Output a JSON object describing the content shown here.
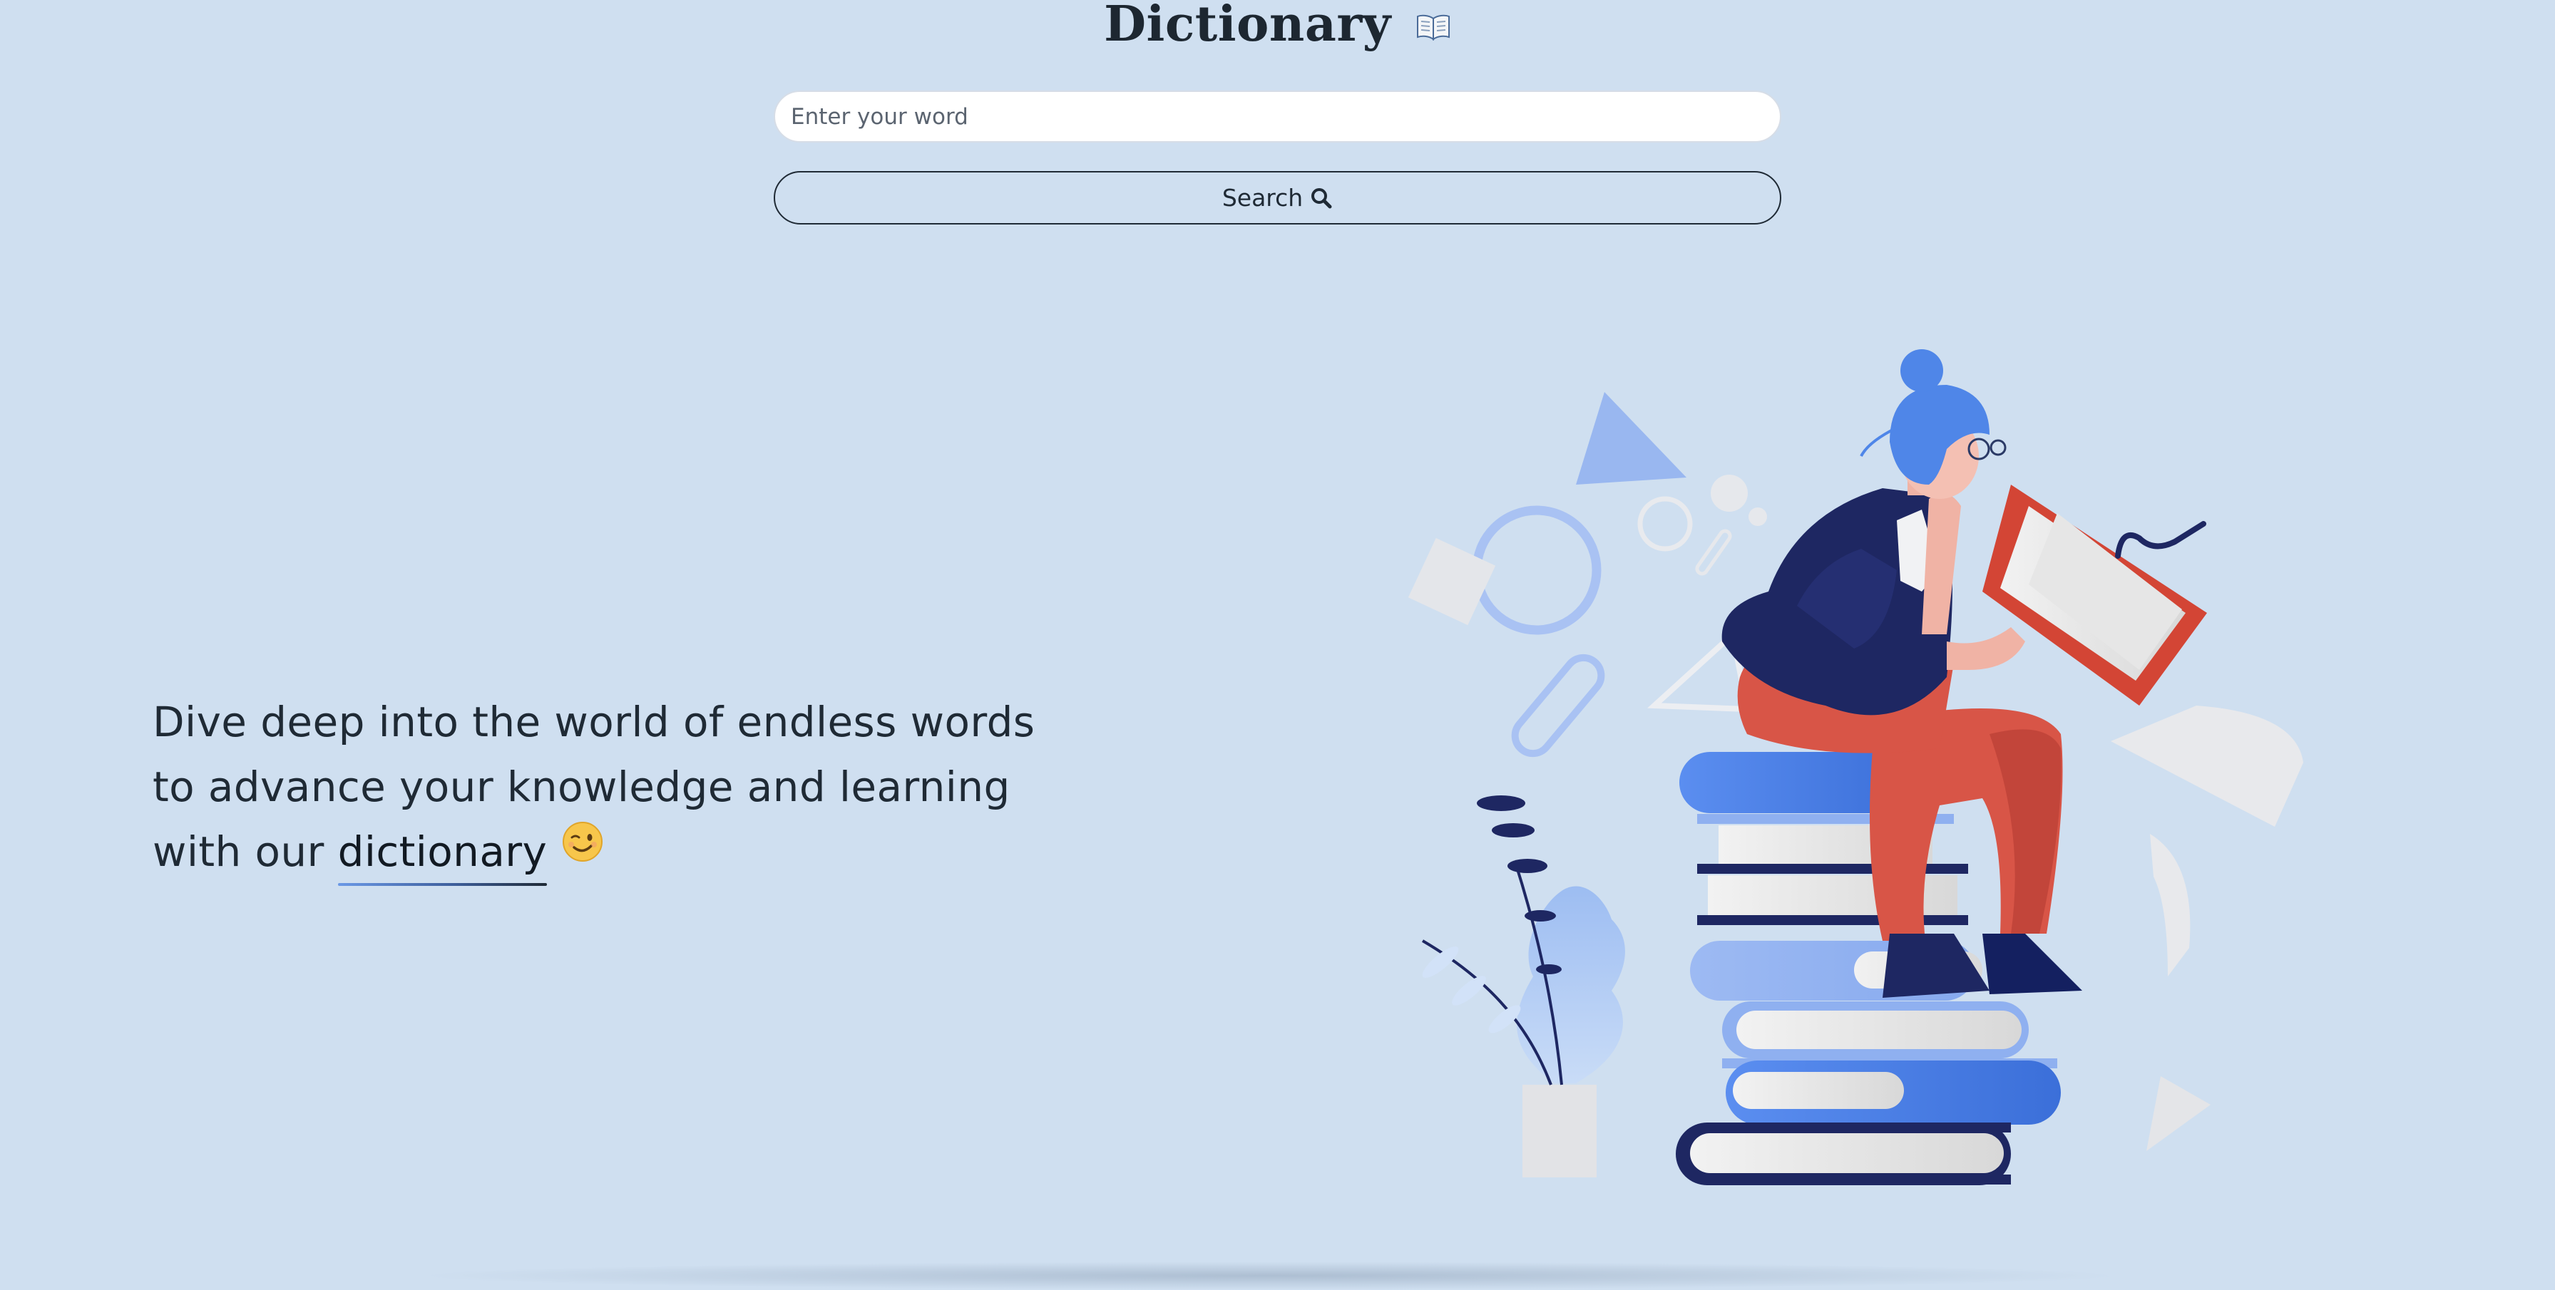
{
  "header": {
    "title": "Dictionary",
    "title_icon": "open-book-emoji"
  },
  "search": {
    "placeholder": "Enter your word",
    "value": "",
    "button_label": "Search",
    "button_icon": "magnifying-glass-icon"
  },
  "hero": {
    "line1": "Dive deep into the world of endless words",
    "line2": "to advance your knowledge and learning",
    "line3_prefix": "with our",
    "highlight_word": "dictionary",
    "emoji": "winking-face-emoji",
    "illustration": "woman-reading-on-stack-of-books"
  },
  "colors": {
    "background": "#cfdff0",
    "text": "#1f2a35",
    "accent_blue": "#4f86e8",
    "navy": "#1e2762",
    "red": "#d85547"
  }
}
